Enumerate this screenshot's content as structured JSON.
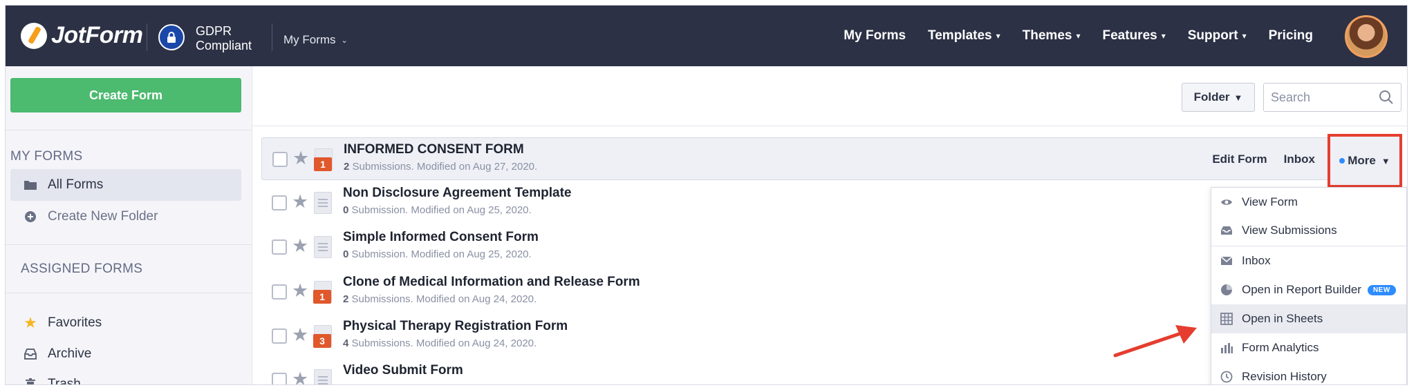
{
  "header": {
    "logo_text": "JotForm",
    "gdpr_line1": "GDPR",
    "gdpr_line2": "Compliant",
    "myforms_dropdown": "My Forms",
    "nav": [
      {
        "label": "My Forms",
        "has_caret": false
      },
      {
        "label": "Templates",
        "has_caret": true
      },
      {
        "label": "Themes",
        "has_caret": true
      },
      {
        "label": "Features",
        "has_caret": true
      },
      {
        "label": "Support",
        "has_caret": true
      },
      {
        "label": "Pricing",
        "has_caret": false
      }
    ]
  },
  "sidebar": {
    "create_button": "Create Form",
    "my_forms_heading": "MY FORMS",
    "all_forms": "All Forms",
    "create_folder": "Create New Folder",
    "assigned_heading": "ASSIGNED FORMS",
    "favorites": "Favorites",
    "archive": "Archive",
    "trash": "Trash"
  },
  "toolbar": {
    "folder_label": "Folder",
    "search_placeholder": "Search"
  },
  "forms": [
    {
      "title": "INFORMED CONSENT FORM",
      "count": "2",
      "sub": " Submissions. Modified on Aug 27, 2020.",
      "badge": "1"
    },
    {
      "title": "Non Disclosure Agreement Template",
      "count": "0",
      "sub": " Submission. Modified on Aug 25, 2020.",
      "badge": ""
    },
    {
      "title": "Simple Informed Consent Form",
      "count": "0",
      "sub": " Submission. Modified on Aug 25, 2020.",
      "badge": ""
    },
    {
      "title": "Clone of Medical Information and Release Form",
      "count": "2",
      "sub": " Submissions. Modified on Aug 24, 2020.",
      "badge": "1"
    },
    {
      "title": "Physical Therapy Registration Form",
      "count": "4",
      "sub": " Submissions. Modified on Aug 24, 2020.",
      "badge": "3"
    },
    {
      "title": "Video Submit Form",
      "count": "",
      "sub": "",
      "badge": ""
    }
  ],
  "row_actions": {
    "edit": "Edit Form",
    "inbox": "Inbox",
    "more": "More"
  },
  "more_menu": {
    "view_form": "View Form",
    "view_submissions": "View Submissions",
    "inbox": "Inbox",
    "report_builder": "Open in Report Builder",
    "new_pill": "NEW",
    "sheets": "Open in Sheets",
    "analytics": "Form Analytics",
    "revision": "Revision History"
  },
  "colors": {
    "header_bg": "#2c3145",
    "create_green": "#4cba6f",
    "annotation_red": "#e53d2f",
    "badge_orange": "#e0582b",
    "accent_blue": "#2d8cff"
  }
}
